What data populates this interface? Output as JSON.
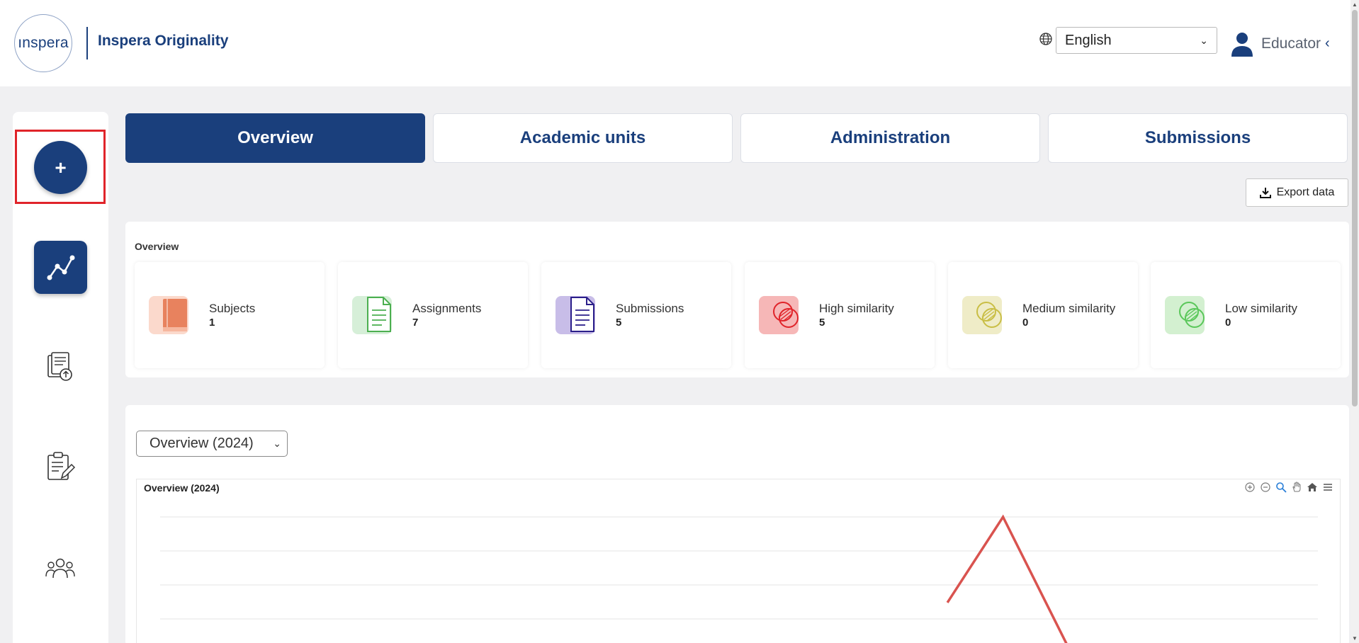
{
  "header": {
    "logo_text": "ınspera",
    "app_title": "Inspera Originality",
    "language": "English",
    "user_role": "Educator"
  },
  "sidebar": {
    "items": [
      {
        "name": "add",
        "icon": "plus-icon",
        "active": false,
        "highlighted": true
      },
      {
        "name": "analytics",
        "icon": "line-chart-icon",
        "active": true
      },
      {
        "name": "documents",
        "icon": "document-upload-icon",
        "active": false
      },
      {
        "name": "assignments",
        "icon": "clipboard-edit-icon",
        "active": false
      },
      {
        "name": "users",
        "icon": "users-icon",
        "active": false
      }
    ],
    "add_label": "+"
  },
  "tabs": [
    {
      "label": "Overview",
      "active": true
    },
    {
      "label": "Academic units",
      "active": false
    },
    {
      "label": "Administration",
      "active": false
    },
    {
      "label": "Submissions",
      "active": false
    }
  ],
  "export": {
    "label": "Export data"
  },
  "overview": {
    "title": "Overview",
    "stats": [
      {
        "label": "Subjects",
        "value": "1",
        "color": "#e8825e",
        "bg": "#fbd9cc",
        "icon": "book-icon"
      },
      {
        "label": "Assignments",
        "value": "7",
        "color": "#4caf50",
        "bg": "#d6efd8",
        "icon": "document-icon"
      },
      {
        "label": "Submissions",
        "value": "5",
        "color": "#2b1f8a",
        "bg": "#c8bde8",
        "icon": "document-icon"
      },
      {
        "label": "High similarity",
        "value": "5",
        "color": "#e0242a",
        "bg": "#f6b7b7",
        "icon": "overlap-circles-icon"
      },
      {
        "label": "Medium similarity",
        "value": "0",
        "color": "#c9be45",
        "bg": "#efecc7",
        "icon": "overlap-circles-icon"
      },
      {
        "label": "Low similarity",
        "value": "0",
        "color": "#5ac75a",
        "bg": "#d3f0d0",
        "icon": "overlap-circles-icon"
      }
    ]
  },
  "chart_section": {
    "select_value": "Overview (2024)",
    "chart_title": "Overview (2024)",
    "tools": [
      "zoom-in-icon",
      "zoom-out-icon",
      "zoom-select-icon",
      "pan-hand-icon",
      "home-icon",
      "menu-icon"
    ]
  },
  "chart_data": {
    "type": "line",
    "title": "Overview (2024)",
    "series": [
      {
        "color": "#d9534f",
        "points": [
          [
            0.68,
            0.35
          ],
          [
            0.728,
            1.0
          ],
          [
            0.785,
            0.0
          ]
        ]
      }
    ],
    "grid": true
  },
  "colors": {
    "brand": "#1a3f7c",
    "highlight": "#e0242a"
  }
}
